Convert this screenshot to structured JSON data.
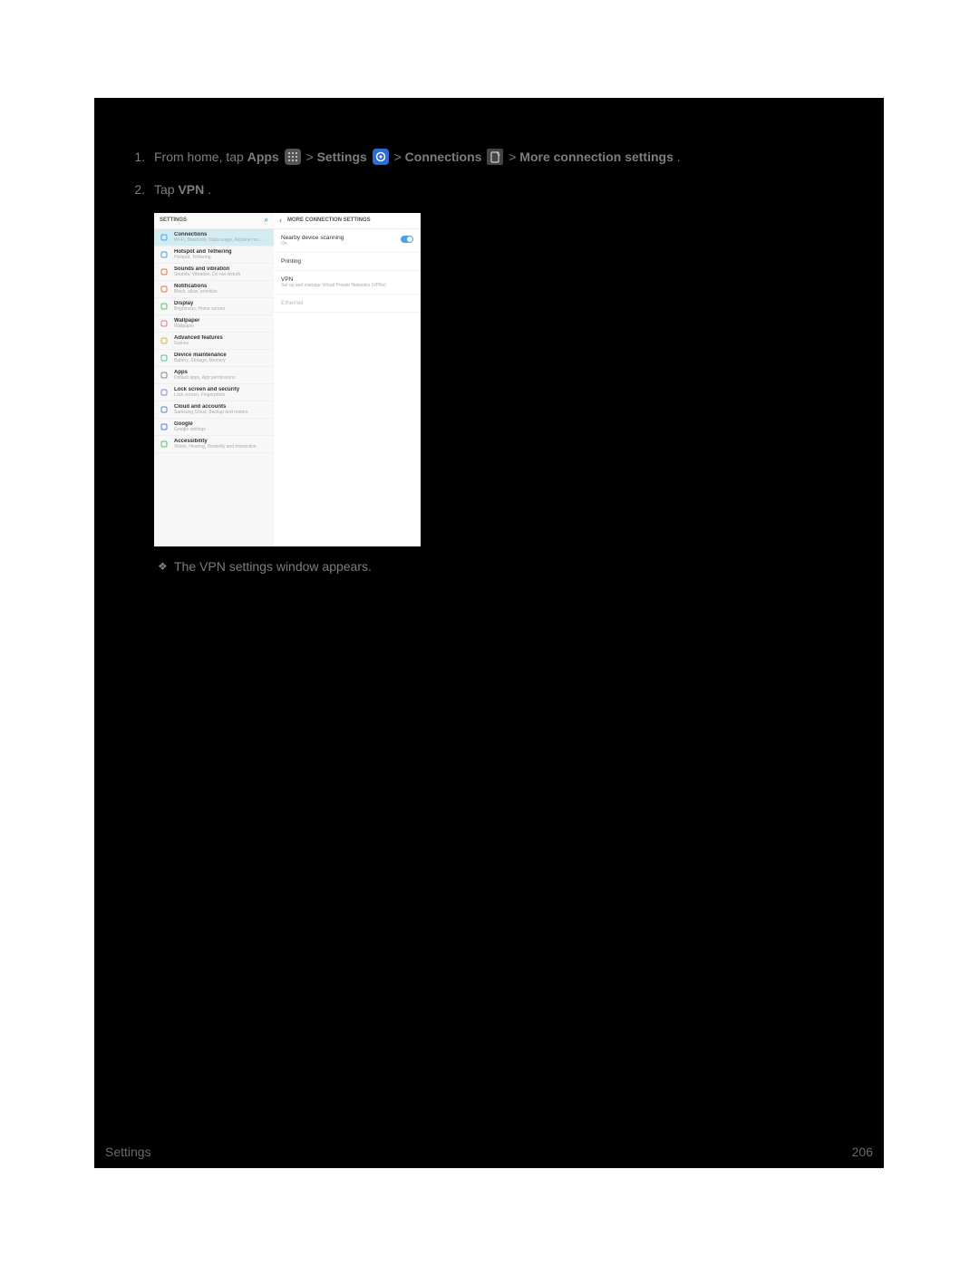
{
  "step1": {
    "num": "1.",
    "prefix": "From home, tap ",
    "apps": "Apps",
    "sep": " > ",
    "settings": "Settings",
    "connections": "Connections",
    "more": "More connection settings",
    "end": "."
  },
  "step2": {
    "num": "2.",
    "prefix": "Tap ",
    "vpn": "VPN",
    "end": "."
  },
  "screenshot": {
    "left_header": "SETTINGS",
    "right_header": "MORE CONNECTION SETTINGS",
    "categories": [
      {
        "title": "Connections",
        "sub": "Wi-Fi, Bluetooth, Data usage, Airplane mo...",
        "color": "#4aa3e0",
        "selected": true
      },
      {
        "title": "Hotspot and Tethering",
        "sub": "Hotspot, Tethering",
        "color": "#4aa3e0"
      },
      {
        "title": "Sounds and vibration",
        "sub": "Sounds, Vibration, Do not disturb",
        "color": "#e07a4a"
      },
      {
        "title": "Notifications",
        "sub": "Block, allow, prioritize",
        "color": "#e07a4a"
      },
      {
        "title": "Display",
        "sub": "Brightness, Home screen",
        "color": "#5bbf6b"
      },
      {
        "title": "Wallpaper",
        "sub": "Wallpaper",
        "color": "#e07aa3"
      },
      {
        "title": "Advanced features",
        "sub": "Games",
        "color": "#e0b34a"
      },
      {
        "title": "Device maintenance",
        "sub": "Battery, Storage, Memory",
        "color": "#5bbfb0"
      },
      {
        "title": "Apps",
        "sub": "Default apps, App permissions",
        "color": "#8a8a8a"
      },
      {
        "title": "Lock screen and security",
        "sub": "Lock screen, Fingerprints",
        "color": "#8a8ae0"
      },
      {
        "title": "Cloud and accounts",
        "sub": "Samsung Cloud, Backup and restore",
        "color": "#5b8abf"
      },
      {
        "title": "Google",
        "sub": "Google settings",
        "color": "#4a80e0"
      },
      {
        "title": "Accessibility",
        "sub": "Vision, Hearing, Dexterity and interaction",
        "color": "#5bbf6b"
      }
    ],
    "right_items": [
      {
        "title": "Nearby device scanning",
        "sub": "On",
        "toggle": true
      },
      {
        "title": "Printing",
        "sub": ""
      },
      {
        "title": "VPN",
        "sub": "Set up and manage Virtual Private Networks (VPNs)"
      },
      {
        "title": "Ethernet",
        "sub": "",
        "dim": true
      }
    ]
  },
  "result": {
    "bullet": "❖",
    "text": "The VPN settings window appears."
  },
  "footer": {
    "section": "Settings",
    "page": "206"
  }
}
